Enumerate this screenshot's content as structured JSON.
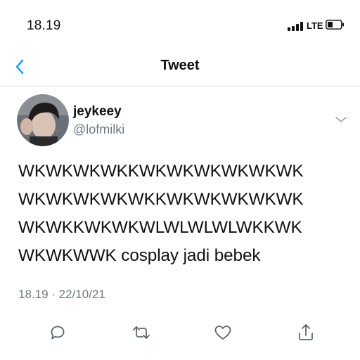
{
  "status_bar": {
    "time": "18.19",
    "network": "LTE"
  },
  "nav": {
    "title": "Tweet",
    "back_icon": "chevron-left-icon"
  },
  "tweet": {
    "display_name": "jeykeey",
    "username": "@lofmilki",
    "text": "WKWKWKWKKWKWKWKWKWKWK\nWKWKWKWKWKKWKWKWKWKWK\nWKWKKWKWKWLWLWLWLWKKWK\nWKWKWWK cosplay jadi bebek",
    "timestamp": "18.19 · 22/10/21"
  },
  "actions": [
    {
      "name": "reply",
      "icon": "reply-icon"
    },
    {
      "name": "retweet",
      "icon": "retweet-icon"
    },
    {
      "name": "like",
      "icon": "heart-icon"
    },
    {
      "name": "share",
      "icon": "share-icon"
    }
  ],
  "colors": {
    "text": "#111111",
    "secondary": "#707a82",
    "accent": "#1da1f2",
    "divider": "#d6d6d6"
  }
}
